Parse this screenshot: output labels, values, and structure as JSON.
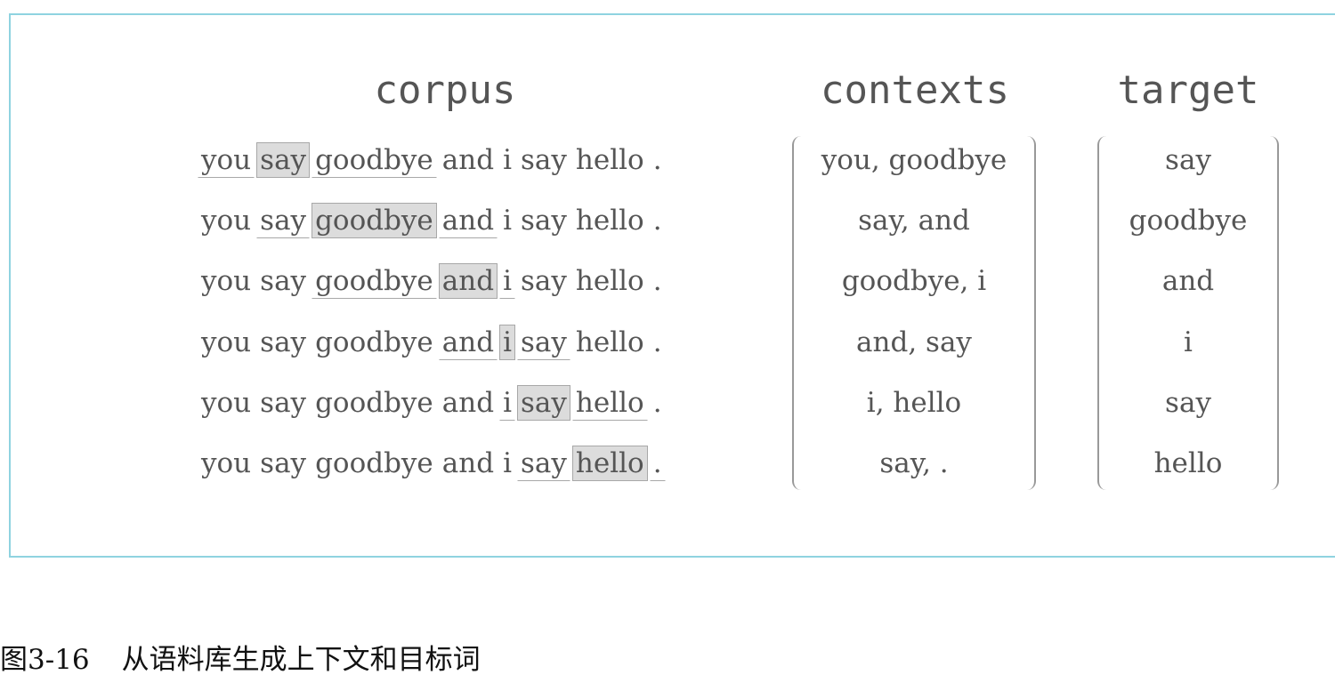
{
  "headings": {
    "corpus": "corpus",
    "contexts": "contexts",
    "target": "target"
  },
  "corpus_rows": [
    {
      "tokens": [
        "you",
        "say",
        "goodbye",
        "and",
        "i",
        "say",
        "hello",
        "."
      ],
      "target_index": 1,
      "context_indices": [
        0,
        2
      ]
    },
    {
      "tokens": [
        "you",
        "say",
        "goodbye",
        "and",
        "i",
        "say",
        "hello",
        "."
      ],
      "target_index": 2,
      "context_indices": [
        1,
        3
      ]
    },
    {
      "tokens": [
        "you",
        "say",
        "goodbye",
        "and",
        "i",
        "say",
        "hello",
        "."
      ],
      "target_index": 3,
      "context_indices": [
        2,
        4
      ]
    },
    {
      "tokens": [
        "you",
        "say",
        "goodbye",
        "and",
        "i",
        "say",
        "hello",
        "."
      ],
      "target_index": 4,
      "context_indices": [
        3,
        5
      ]
    },
    {
      "tokens": [
        "you",
        "say",
        "goodbye",
        "and",
        "i",
        "say",
        "hello",
        "."
      ],
      "target_index": 5,
      "context_indices": [
        4,
        6
      ]
    },
    {
      "tokens": [
        "you",
        "say",
        "goodbye",
        "and",
        "i",
        "say",
        "hello",
        "."
      ],
      "target_index": 6,
      "context_indices": [
        5,
        7
      ]
    }
  ],
  "contexts": [
    "you, goodbye",
    "say, and",
    "goodbye, i",
    "and, say",
    "i, hello",
    "say, ."
  ],
  "targets": [
    "say",
    "goodbye",
    "and",
    "i",
    "say",
    "hello"
  ],
  "caption": {
    "label": "图3-16",
    "text": "从语料库生成上下文和目标词"
  },
  "colors": {
    "frame": "#8fd3e0",
    "highlight": "#dcdcdc",
    "text": "#555555"
  }
}
